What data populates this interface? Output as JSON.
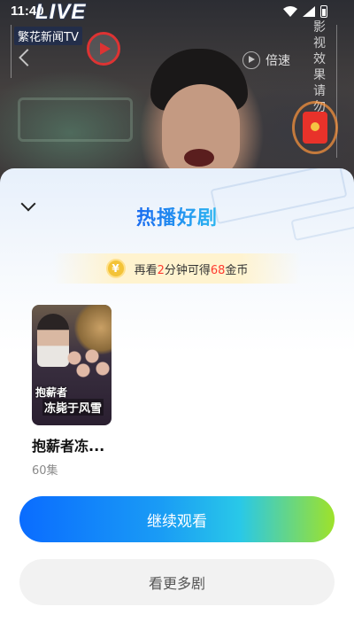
{
  "status_bar": {
    "time": "11:40"
  },
  "video": {
    "live_logo": "LIVE",
    "channel_name": "繁花新闻TV",
    "speed_label": "倍速",
    "vertical_text": "影视效果 请勿"
  },
  "sheet": {
    "title": "热播好剧",
    "reward": {
      "coin_symbol": "¥",
      "prefix": "再看",
      "minutes": "2",
      "middle": "分钟可得",
      "coins": "68",
      "suffix": "金币"
    },
    "dramas": [
      {
        "poster_text_line1": "抱薪者",
        "poster_text_line2": "冻毙于风雪",
        "name": "抱薪者冻...",
        "episodes": "60集"
      }
    ],
    "continue_button": "继续观看",
    "more_button": "看更多剧"
  },
  "colors": {
    "accent_blue": "#1a6bf0",
    "gradient_end_green": "#9ee22a",
    "highlight_red": "#ff3b30",
    "coin_gold": "#f3c338"
  }
}
